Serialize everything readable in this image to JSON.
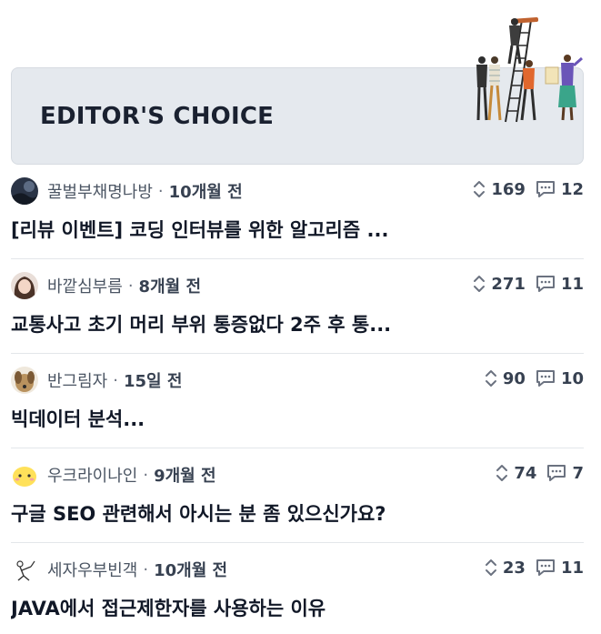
{
  "banner": {
    "title": "EDITOR'S CHOICE",
    "illustration": "people-on-ladder-illustration"
  },
  "posts": [
    {
      "author": "꿀벌부채명나방",
      "time": "10개월 전",
      "votes": "169",
      "comments": "12",
      "title": "[리뷰 이벤트] 코딩 인터뷰를 위한 알고리즘 ..."
    },
    {
      "author": "바깥심부름",
      "time": "8개월 전",
      "votes": "271",
      "comments": "11",
      "title": "교통사고 초기 머리 부위 통증없다 2주 후 통..."
    },
    {
      "author": "반그림자",
      "time": "15일 전",
      "votes": "90",
      "comments": "10",
      "title": "빅데이터 분석..."
    },
    {
      "author": "우크라이나인",
      "time": "9개월 전",
      "votes": "74",
      "comments": "7",
      "title": "구글 SEO 관련해서 아시는 분 좀 있으신가요?"
    },
    {
      "author": "세자우부빈객",
      "time": "10개월 전",
      "votes": "23",
      "comments": "11",
      "title": "JAVA에서 접근제한자를 사용하는 이유"
    }
  ],
  "separator": "·",
  "icons": {
    "vote": "up-down-chevron-icon",
    "comment": "speech-bubble-icon"
  },
  "colors": {
    "banner_bg": "#e5e9ee",
    "title_text": "#111827",
    "meta_text": "#4b5563"
  }
}
